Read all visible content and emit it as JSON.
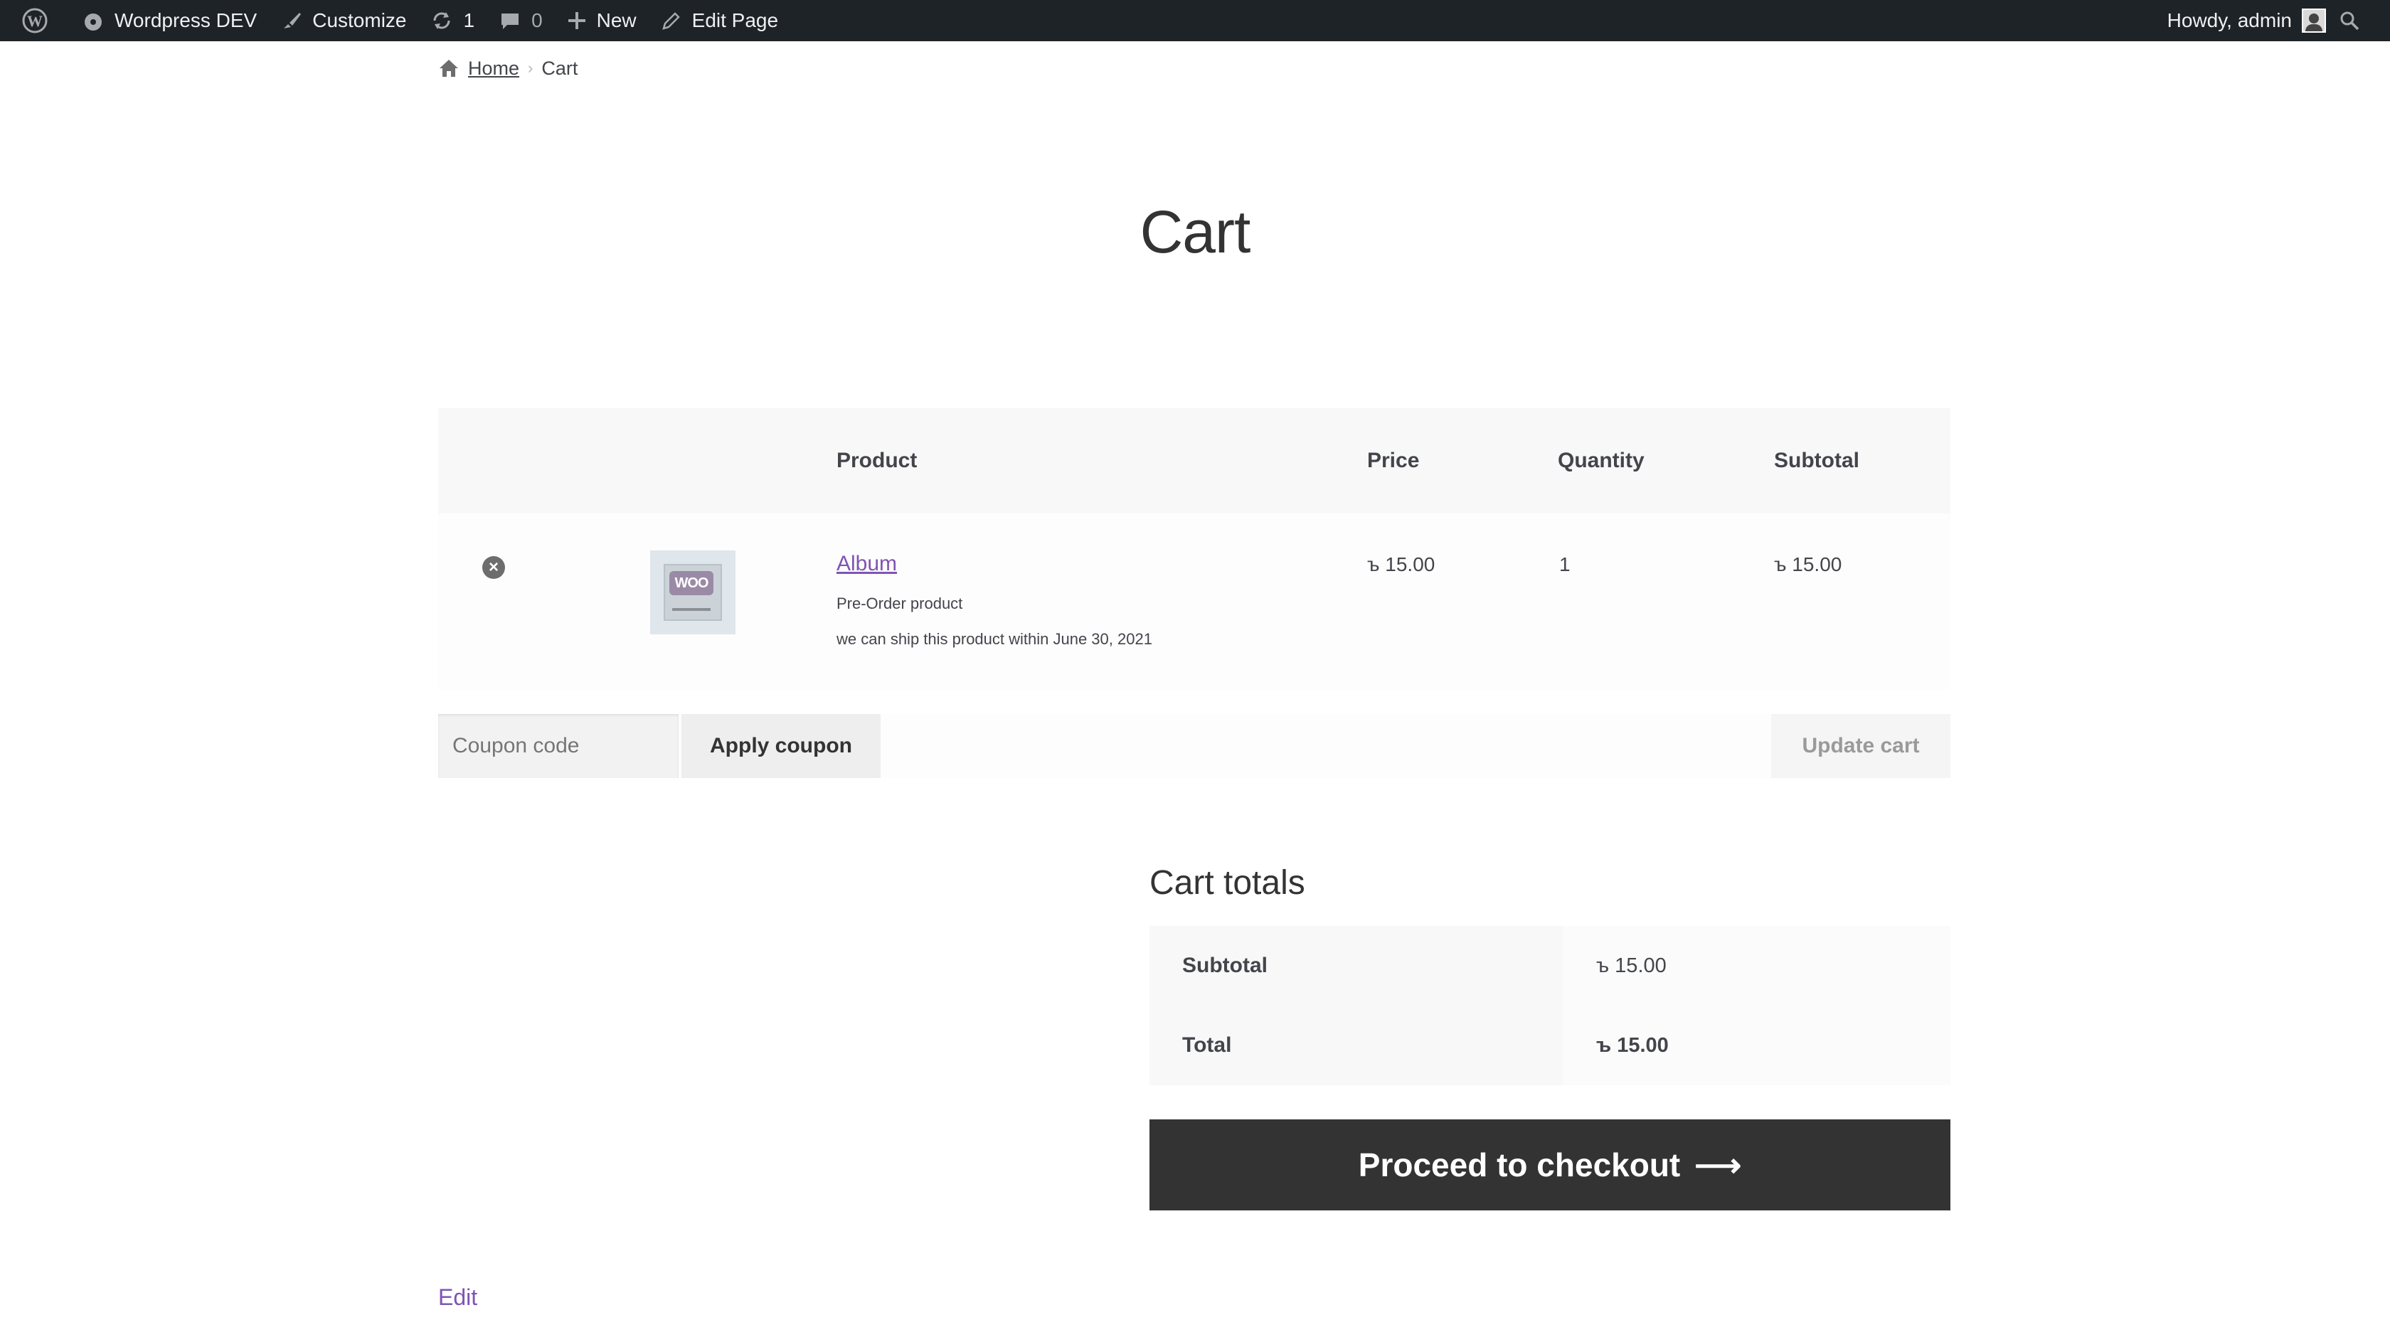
{
  "adminbar": {
    "site_name": "Wordpress DEV",
    "customize": "Customize",
    "updates_count": "1",
    "comments_count": "0",
    "new": "New",
    "edit_page": "Edit Page",
    "howdy": "Howdy, admin"
  },
  "breadcrumb": {
    "home": "Home",
    "current": "Cart"
  },
  "page": {
    "title": "Cart"
  },
  "cart": {
    "headers": {
      "product": "Product",
      "price": "Price",
      "quantity": "Quantity",
      "subtotal": "Subtotal"
    },
    "items": [
      {
        "remove": "×",
        "thumb_text": "WOO",
        "name": "Album",
        "meta1": "Pre-Order product",
        "meta2": "we can ship this product within June 30, 2021",
        "price": "ъ 15.00",
        "quantity": "1",
        "subtotal": "ъ 15.00"
      }
    ],
    "coupon_placeholder": "Coupon code",
    "apply_coupon": "Apply coupon",
    "update_cart": "Update cart"
  },
  "totals": {
    "title": "Cart totals",
    "subtotal_label": "Subtotal",
    "subtotal_value": "ъ 15.00",
    "total_label": "Total",
    "total_value": "ъ 15.00",
    "checkout": "Proceed to checkout",
    "checkout_arrow": "⟶"
  },
  "footer": {
    "edit": "Edit"
  },
  "colors": {
    "accent": "#7f54b3",
    "adminbar": "#1d2327",
    "checkout_bg": "#333333"
  }
}
